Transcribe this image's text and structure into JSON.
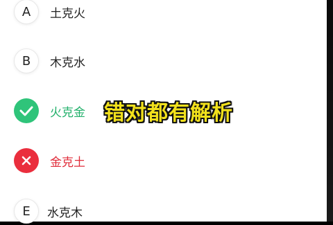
{
  "options": [
    {
      "letter": "A",
      "text": "土克火",
      "state": "normal"
    },
    {
      "letter": "B",
      "text": "木克水",
      "state": "normal"
    },
    {
      "letter": "",
      "text": "火克金",
      "state": "correct",
      "icon": "check-icon"
    },
    {
      "letter": "",
      "text": "金克土",
      "state": "wrong",
      "icon": "cross-icon"
    },
    {
      "letter": "E",
      "text": "水克木",
      "state": "normal"
    }
  ],
  "overlay_caption": "错对都有解析",
  "colors": {
    "correct": "#2fc47a",
    "wrong": "#ea2e3d",
    "caption": "#f2e11c"
  }
}
